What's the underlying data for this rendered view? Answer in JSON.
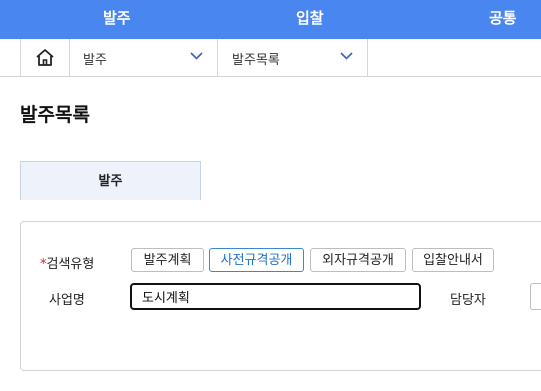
{
  "top_nav": {
    "items": [
      {
        "label": "발주"
      },
      {
        "label": "입찰"
      },
      {
        "label": "공통"
      }
    ],
    "bg_color": "#4a86f0"
  },
  "breadcrumb": {
    "home_icon": "home-icon",
    "crumbs": [
      {
        "label": "발주"
      },
      {
        "label": "발주목록"
      }
    ]
  },
  "page": {
    "title": "발주목록"
  },
  "tabs": [
    {
      "label": "발주",
      "selected": true
    }
  ],
  "search": {
    "type_label": "검색유형",
    "required_mark": "*",
    "type_options": [
      {
        "label": "발주계획",
        "selected": false
      },
      {
        "label": "사전규격공개",
        "selected": true
      },
      {
        "label": "외자규격공개",
        "selected": false
      },
      {
        "label": "입찰안내서",
        "selected": false
      }
    ],
    "business_label": "사업명",
    "business_value": "도시계획",
    "manager_label": "담당자",
    "manager_value": ""
  },
  "colors": {
    "accent": "#1f72c8",
    "required": "#e0202a"
  }
}
